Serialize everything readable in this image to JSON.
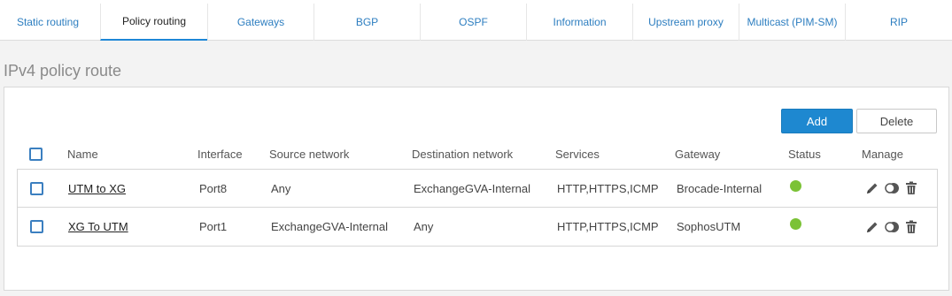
{
  "tabs": [
    {
      "label": "Static routing",
      "active": false
    },
    {
      "label": "Policy routing",
      "active": true
    },
    {
      "label": "Gateways",
      "active": false
    },
    {
      "label": "BGP",
      "active": false
    },
    {
      "label": "OSPF",
      "active": false
    },
    {
      "label": "Information",
      "active": false
    },
    {
      "label": "Upstream proxy",
      "active": false
    },
    {
      "label": "Multicast (PIM-SM)",
      "active": false
    },
    {
      "label": "RIP",
      "active": false
    }
  ],
  "section": {
    "title": "IPv4 policy route"
  },
  "toolbar": {
    "add_label": "Add",
    "delete_label": "Delete"
  },
  "table": {
    "headers": {
      "name": "Name",
      "interface": "Interface",
      "source": "Source network",
      "destination": "Destination network",
      "services": "Services",
      "gateway": "Gateway",
      "status": "Status",
      "manage": "Manage"
    },
    "rows": [
      {
        "name": "UTM to XG",
        "interface": "Port8",
        "source": "Any",
        "destination": "ExchangeGVA-Internal",
        "services": "HTTP,HTTPS,ICMP",
        "gateway": "Brocade-Internal",
        "status": "enabled"
      },
      {
        "name": "XG To UTM",
        "interface": "Port1",
        "source": "ExchangeGVA-Internal",
        "destination": "Any",
        "services": "HTTP,HTTPS,ICMP",
        "gateway": "SophosUTM",
        "status": "enabled"
      }
    ]
  },
  "colors": {
    "accent": "#1e88d0",
    "status_on": "#7bc236",
    "tab_text": "#2d7ec0"
  },
  "icons": {
    "edit": "pencil-icon",
    "toggle": "toggle-icon",
    "delete": "trash-icon"
  }
}
